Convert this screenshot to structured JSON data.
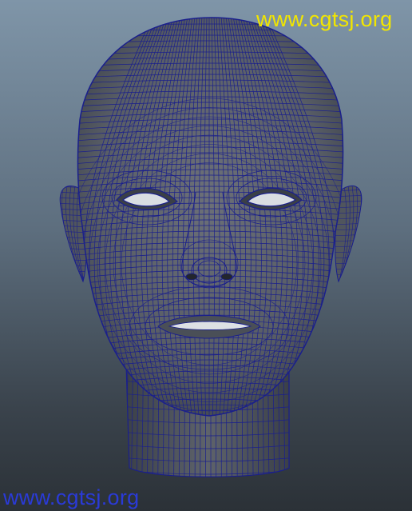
{
  "watermark_top": {
    "text": "www.cgtsj.org",
    "color": "#f2e600"
  },
  "watermark_bottom": {
    "text": "www.cgtsj.org",
    "color": "#2a3ad8"
  },
  "colors": {
    "background_top": "#7f95a8",
    "background_bottom": "#2b3137",
    "surface": "#5b6068",
    "wireframe": "#1a1f8c"
  },
  "viewport": {
    "subject": "wireframe head model",
    "shading": "smooth shade with wireframe"
  }
}
